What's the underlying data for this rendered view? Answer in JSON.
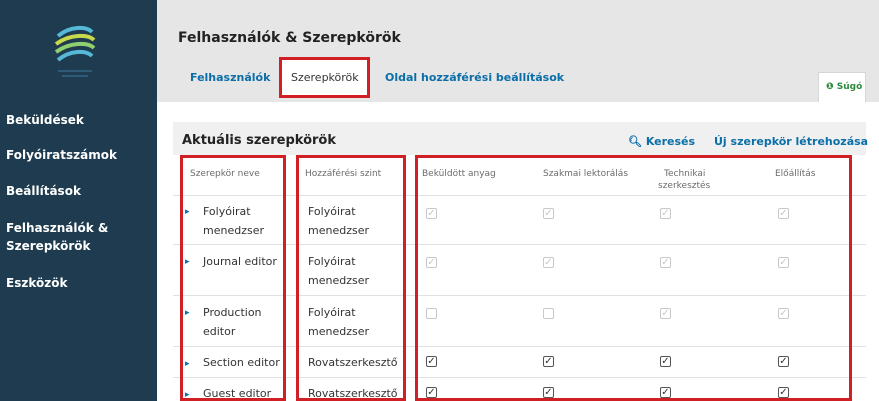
{
  "sidebar": {
    "items": [
      {
        "label": "Beküldések"
      },
      {
        "label": "Folyóiratszámok"
      },
      {
        "label": "Beállítások"
      },
      {
        "label": "Felhasználók &"
      },
      {
        "label": "Szerepkörök"
      },
      {
        "label": "Eszközök"
      }
    ]
  },
  "header": {
    "title": "Felhasználók & Szerepkörök",
    "tabs": [
      {
        "label": "Felhasználók"
      },
      {
        "label": "Szerepkörök"
      },
      {
        "label": "Oldal hozzáférési beállítások"
      }
    ],
    "help_label": "Súgó",
    "help_icon": "help-icon"
  },
  "panel": {
    "title": "Aktuális szerepkörök",
    "search_label": "Keresés",
    "create_label": "Új szerepkör létrehozása",
    "columns": {
      "role": "Szerepkör neve",
      "access": "Hozzáférési szint",
      "submission": "Beküldött anyag",
      "review": "Szakmai lektorálás",
      "tech_line1": "Technikai",
      "tech_line2": "szerkesztés",
      "production": "Előállítás"
    },
    "rows": [
      {
        "name1": "Folyóirat",
        "name2": "menedzser",
        "access1": "Folyóirat",
        "access2": "menedzser",
        "checks": [
          true,
          true,
          true,
          true
        ]
      },
      {
        "name1": "Journal editor",
        "name2": "",
        "access1": "Folyóirat",
        "access2": "menedzser",
        "checks": [
          true,
          true,
          true,
          true
        ]
      },
      {
        "name1": "Production",
        "name2": "editor",
        "access1": "Folyóirat",
        "access2": "menedzser",
        "checks": [
          false,
          false,
          true,
          true
        ]
      },
      {
        "name1": "Section editor",
        "name2": "",
        "access1": "Rovatszerkesztő",
        "access2": "",
        "checks": [
          true,
          true,
          true,
          true
        ]
      },
      {
        "name1": "Guest editor",
        "name2": "",
        "access1": "Rovatszerkesztő",
        "access2": "",
        "checks": [
          true,
          true,
          true,
          true
        ]
      }
    ]
  },
  "colors": {
    "sidebar_bg": "#1e3b4f",
    "link": "#0a6ea8",
    "highlight_red": "#d01f25",
    "help_green": "#2b8a3e"
  }
}
